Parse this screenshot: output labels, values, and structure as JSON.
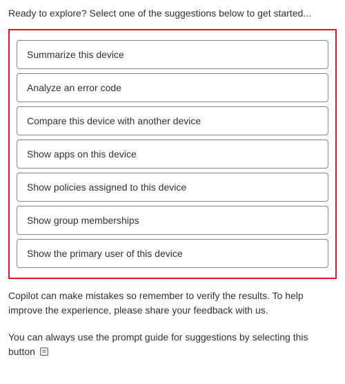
{
  "intro": "Ready to explore? Select one of the suggestions below to get started...",
  "suggestions": {
    "items": [
      {
        "label": "Summarize this device"
      },
      {
        "label": "Analyze an error code"
      },
      {
        "label": "Compare this device with another device"
      },
      {
        "label": "Show apps on this device"
      },
      {
        "label": "Show policies assigned to this device"
      },
      {
        "label": "Show group memberships"
      },
      {
        "label": "Show the primary user of this device"
      }
    ]
  },
  "disclaimer": "Copilot can make mistakes so remember to verify the results. To help improve the experience, please share your feedback with us.",
  "hint": "You can always use the prompt guide for suggestions by selecting this button"
}
